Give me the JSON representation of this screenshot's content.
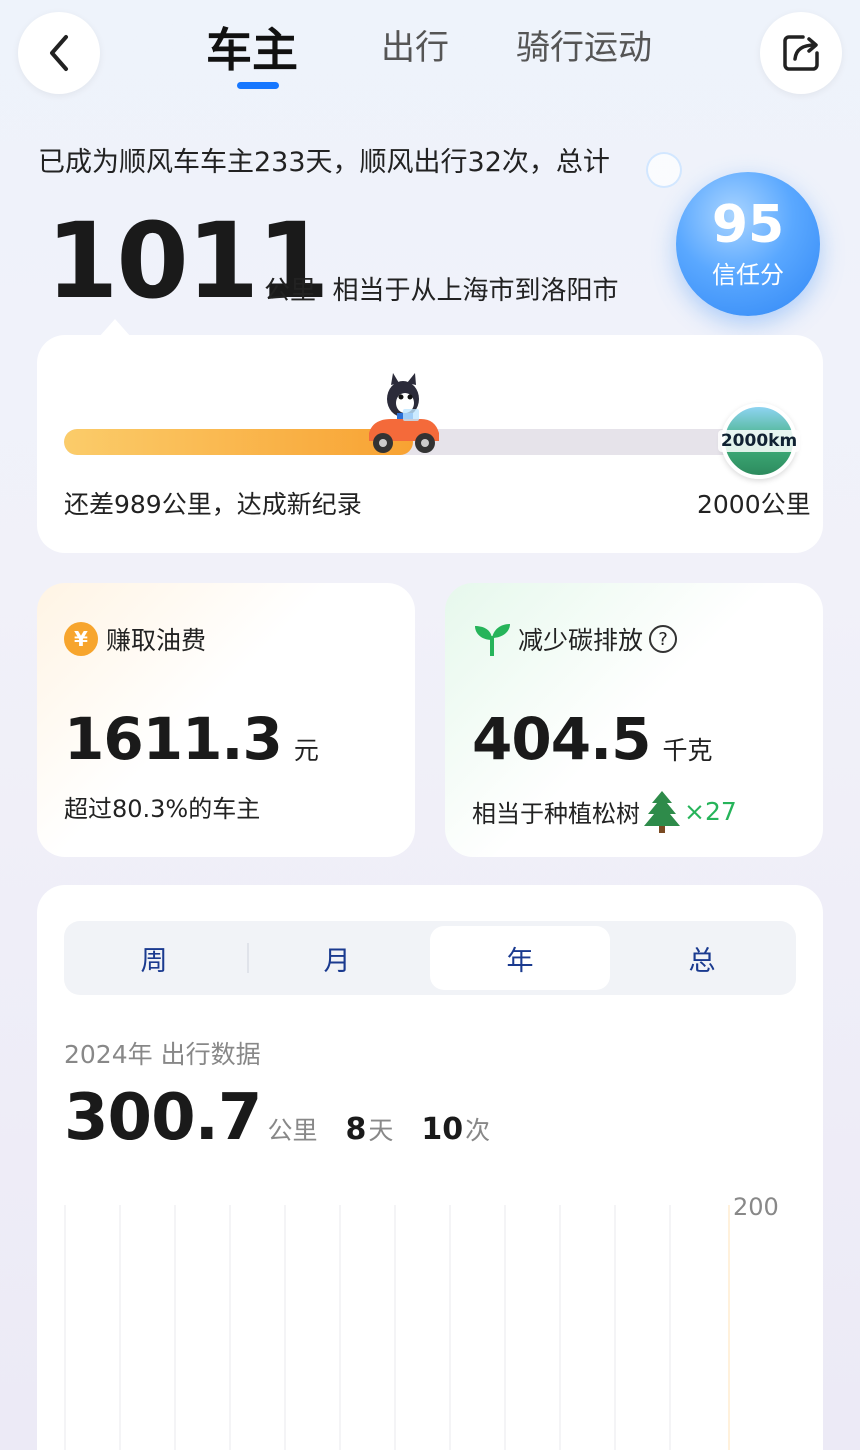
{
  "header": {
    "tabs": [
      {
        "label": "车主",
        "active": true
      },
      {
        "label": "出行",
        "active": false
      },
      {
        "label": "骑行运动",
        "active": false
      }
    ],
    "back_icon": "chevron-left-icon",
    "share_icon": "share-icon"
  },
  "summary": {
    "text": "已成为顺风车车主233天，顺风出行32次，总计",
    "total_distance": "1011",
    "distance_desc": "公里  相当于从上海市到洛阳市"
  },
  "trust": {
    "score": "95",
    "label": "信任分"
  },
  "progress": {
    "current_km": 1011,
    "goal_km": 2000,
    "fraction": 0.5055,
    "remaining_text": "还差989公里，达成新纪录",
    "goal_text": "2000公里",
    "badge_text": "2000km"
  },
  "fuel": {
    "title": "赚取油费",
    "value": "1611.3",
    "unit": "元",
    "note": "超过80.3%的车主"
  },
  "carbon": {
    "title": "减少碳排放",
    "value": "404.5",
    "unit": "千克",
    "note": "相当于种植松树",
    "tree_count": "×27"
  },
  "stats": {
    "period_tabs": [
      {
        "label": "周",
        "active": false
      },
      {
        "label": "月",
        "active": false
      },
      {
        "label": "年",
        "active": true
      },
      {
        "label": "总",
        "active": false
      }
    ],
    "title": "2024年 出行数据",
    "distance": "300.7",
    "distance_unit": "公里",
    "days": "8",
    "days_unit": "天",
    "trips": "10",
    "trips_unit": "次",
    "chart_max_label": "200"
  },
  "colors": {
    "accent": "#1677ff",
    "progress_start": "#fbcc6a",
    "progress_end": "#f8a232",
    "trust_badge": "#2f86f5",
    "tree_count": "#26b45a",
    "coin": "#f7a52d"
  }
}
